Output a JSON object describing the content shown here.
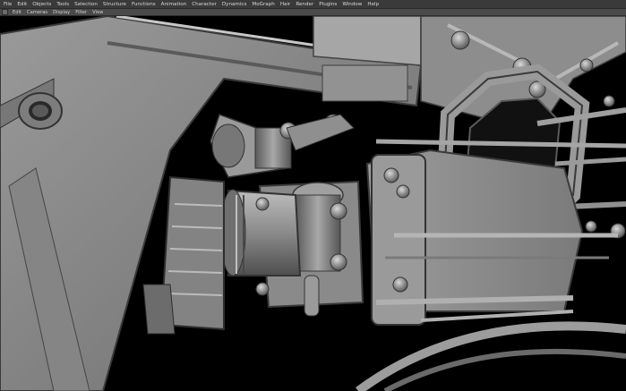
{
  "menu": {
    "items": [
      "File",
      "Edit",
      "Objects",
      "Tools",
      "Selection",
      "Structure",
      "Functions",
      "Animation",
      "Character",
      "Dynamics",
      "MoGraph",
      "Hair",
      "Render",
      "Plugins",
      "Window",
      "Help"
    ]
  },
  "viewport_menu": {
    "items": [
      "Edit",
      "Cameras",
      "Display",
      "Filter",
      "View"
    ]
  },
  "viewport": {
    "scene_subject": "engine-mechanical-model",
    "background_color": "#000000",
    "model_color": "#8a8a8a"
  }
}
